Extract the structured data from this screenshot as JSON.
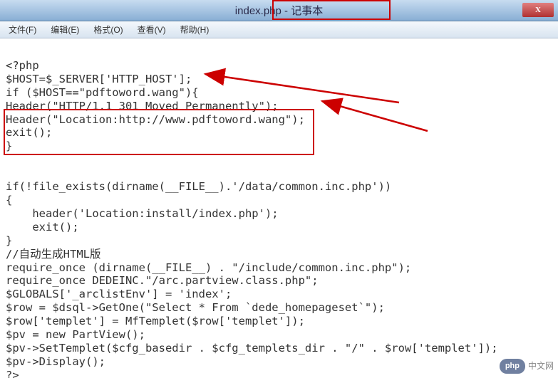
{
  "window": {
    "title": "index.php - 记事本",
    "close": "X"
  },
  "menu": {
    "file": "文件(F)",
    "edit": "编辑(E)",
    "format": "格式(O)",
    "view": "查看(V)",
    "help": "帮助(H)"
  },
  "code": {
    "l1": "<?php",
    "l2": "$HOST=$_SERVER['HTTP_HOST'];",
    "l3": "if ($HOST==\"pdftoword.wang\"){",
    "l4": "Header(\"HTTP/1.1 301 Moved Permanently\");",
    "l5": "Header(\"Location:http://www.pdftoword.wang\");",
    "l6": "exit();",
    "l7": "}",
    "l8": "",
    "l9": "",
    "l10": "if(!file_exists(dirname(__FILE__).'/data/common.inc.php'))",
    "l11": "{",
    "l12": "    header('Location:install/index.php');",
    "l13": "    exit();",
    "l14": "}",
    "l15": "//自动生成HTML版",
    "l16": "require_once (dirname(__FILE__) . \"/include/common.inc.php\");",
    "l17": "require_once DEDEINC.\"/arc.partview.class.php\";",
    "l18": "$GLOBALS['_arclistEnv'] = 'index';",
    "l19": "$row = $dsql->GetOne(\"Select * From `dede_homepageset`\");",
    "l20": "$row['templet'] = MfTemplet($row['templet']);",
    "l21": "$pv = new PartView();",
    "l22": "$pv->SetTemplet($cfg_basedir . $cfg_templets_dir . \"/\" . $row['templet']);",
    "l23": "$pv->Display();",
    "l24": "?>"
  },
  "watermark": {
    "badge": "php",
    "text": "中文网"
  }
}
